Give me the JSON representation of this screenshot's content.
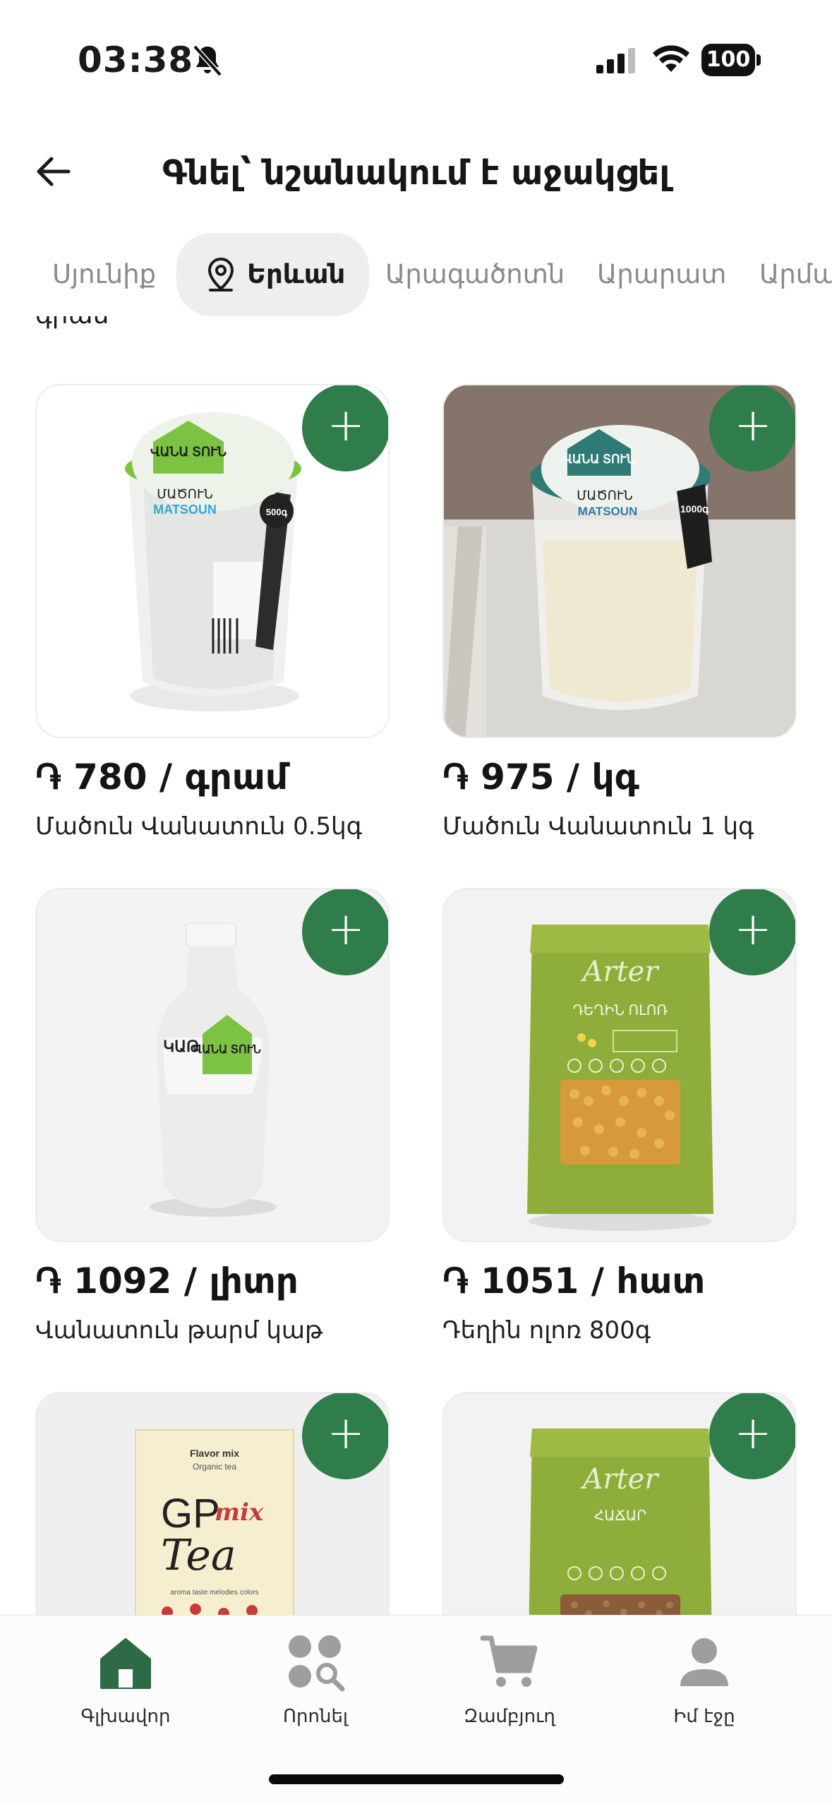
{
  "status_bar": {
    "time": "03:38",
    "battery": "100",
    "icons": [
      "bell-slash-icon",
      "signal-icon",
      "wifi-icon",
      "battery-icon"
    ]
  },
  "header": {
    "title": "Գնել՝ նշանակում է աջակցել",
    "back_icon": "arrow-left-icon"
  },
  "tabs": [
    {
      "label": "Սյունիք",
      "active": false
    },
    {
      "label": "Երևան",
      "active": true,
      "icon": "map-pin-icon"
    },
    {
      "label": "Արագածոտն",
      "active": false
    },
    {
      "label": "Արարատ",
      "active": false
    },
    {
      "label": "Արմավիր",
      "active": false
    }
  ],
  "cutoff_text": "գրամ",
  "products": [
    {
      "price": "֏ 780 / գրամ",
      "name": "Մածուն Վանատուն 0.5կգ",
      "image": "matsoun-cup-500g"
    },
    {
      "price": "֏ 975 / կգ",
      "name": "Մածուն Վանատուն 1 կգ",
      "image": "matsoun-cup-1000g"
    },
    {
      "price": "֏ 1092 / լիտր",
      "name": "Վանատուն թարմ կաթ",
      "image": "milk-bottle"
    },
    {
      "price": "֏ 1051 / հատ",
      "name": "Դեղին ոլոռ 800գ",
      "image": "yellow-peas-bag"
    },
    {
      "price": "",
      "name": "",
      "image": "gp-mix-tea-box"
    },
    {
      "price": "",
      "name": "",
      "image": "arter-grain-bag"
    }
  ],
  "image_text": {
    "vanatun_brand": "ՎԱՆԱ ՏՈՒՆ",
    "matsoun_hy": "ՄԱԾՈՒՆ",
    "matsoun_en": "MATSOUN",
    "weight_500": "500գ",
    "weight_1000": "1000գ",
    "milk_label": "ԿԱԹ",
    "arter_brand": "Arter",
    "peas_label": "ԴԵՂԻՆ ՈԼՈՌ",
    "tea_top": "Flavor mix",
    "tea_sub": "Organic tea",
    "tea_brand_1": "GP",
    "tea_brand_2": "Tea",
    "tea_mix": "mix",
    "tea_bottom": "aroma taste melodies colors",
    "grain_label": "ՀԱՃԱՐ"
  },
  "bottom_nav": [
    {
      "label": "Գլխավոր",
      "icon": "home-icon",
      "active": true
    },
    {
      "label": "Որոնել",
      "icon": "search-categories-icon",
      "active": false
    },
    {
      "label": "Զամբյուղ",
      "icon": "cart-icon",
      "active": false
    },
    {
      "label": "Իմ էջը",
      "icon": "user-icon",
      "active": false
    }
  ],
  "colors": {
    "accent": "#2e7d4b",
    "tab_active_bg": "#eceeef",
    "inactive_text": "#8a8a8a"
  }
}
